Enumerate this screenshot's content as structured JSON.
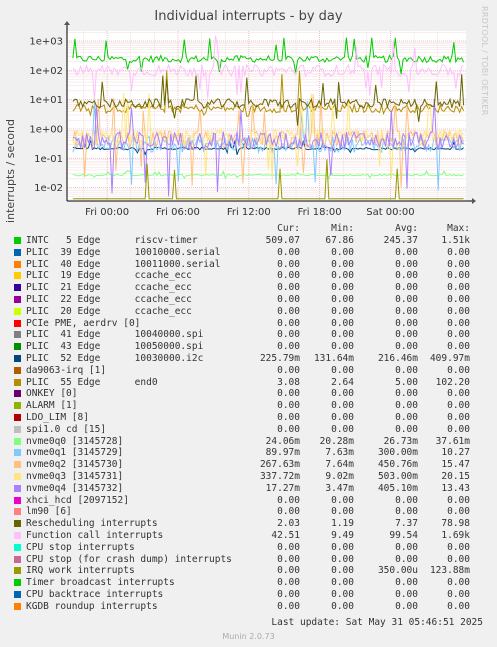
{
  "chart_data": {
    "type": "line",
    "title": "Individual interrupts - by day",
    "ylabel": "interrupts / second",
    "yscale": "log",
    "ylim": [
      0.0035,
      2200
    ],
    "y_ticks": [
      0.01,
      0.1,
      1,
      10,
      100,
      1000
    ],
    "y_tick_labels": [
      "1e-02",
      "1e-01",
      "1e+00",
      "1e+01",
      "1e+02",
      "1e+03"
    ],
    "x_ticks": [
      "Fri 00:00",
      "Fri 06:00",
      "Fri 12:00",
      "Fri 18:00",
      "Sat 00:00"
    ],
    "x_hours": [
      0,
      6,
      12,
      18,
      24
    ],
    "x_range_hours": [
      -3.4,
      30.4
    ],
    "grid": true,
    "legend_columns": [
      "Cur:",
      "Min:",
      "Avg:",
      "Max:"
    ],
    "series": [
      {
        "name": "INTC   5 Edge      riscv-timer",
        "color": "#00cc00",
        "cur": "509.07",
        "min": "67.86",
        "avg": "245.37",
        "max": "1.51k"
      },
      {
        "name": "PLIC  39 Edge      10010000.serial",
        "color": "#0066b3",
        "cur": "0.00",
        "min": "0.00",
        "avg": "0.00",
        "max": "0.00"
      },
      {
        "name": "PLIC  40 Edge      10011000.serial",
        "color": "#ff8000",
        "cur": "0.00",
        "min": "0.00",
        "avg": "0.00",
        "max": "0.00"
      },
      {
        "name": "PLIC  19 Edge      ccache_ecc",
        "color": "#ffcc00",
        "cur": "0.00",
        "min": "0.00",
        "avg": "0.00",
        "max": "0.00"
      },
      {
        "name": "PLIC  21 Edge      ccache_ecc",
        "color": "#330099",
        "cur": "0.00",
        "min": "0.00",
        "avg": "0.00",
        "max": "0.00"
      },
      {
        "name": "PLIC  22 Edge      ccache_ecc",
        "color": "#990099",
        "cur": "0.00",
        "min": "0.00",
        "avg": "0.00",
        "max": "0.00"
      },
      {
        "name": "PLIC  20 Edge      ccache_ecc",
        "color": "#ccff00",
        "cur": "0.00",
        "min": "0.00",
        "avg": "0.00",
        "max": "0.00"
      },
      {
        "name": "PCIe PME, aerdrv [0]",
        "color": "#ff0000",
        "cur": "0.00",
        "min": "0.00",
        "avg": "0.00",
        "max": "0.00"
      },
      {
        "name": "PLIC  41 Edge      10040000.spi",
        "color": "#808080",
        "cur": "0.00",
        "min": "0.00",
        "avg": "0.00",
        "max": "0.00"
      },
      {
        "name": "PLIC  43 Edge      10050000.spi",
        "color": "#008f00",
        "cur": "0.00",
        "min": "0.00",
        "avg": "0.00",
        "max": "0.00"
      },
      {
        "name": "PLIC  52 Edge      10030000.i2c",
        "color": "#00487d",
        "cur": "225.79m",
        "min": "131.64m",
        "avg": "216.46m",
        "max": "409.97m"
      },
      {
        "name": "da9063-irq [1]",
        "color": "#b35a00",
        "cur": "0.00",
        "min": "0.00",
        "avg": "0.00",
        "max": "0.00"
      },
      {
        "name": "PLIC  55 Edge      end0",
        "color": "#b38f00",
        "cur": "3.08",
        "min": "2.64",
        "avg": "5.00",
        "max": "102.20"
      },
      {
        "name": "ONKEY [0]",
        "color": "#6b006b",
        "cur": "0.00",
        "min": "0.00",
        "avg": "0.00",
        "max": "0.00"
      },
      {
        "name": "ALARM [1]",
        "color": "#8fb300",
        "cur": "0.00",
        "min": "0.00",
        "avg": "0.00",
        "max": "0.00"
      },
      {
        "name": "LDO_LIM [8]",
        "color": "#b30000",
        "cur": "0.00",
        "min": "0.00",
        "avg": "0.00",
        "max": "0.00"
      },
      {
        "name": "spi1.0 cd [15]",
        "color": "#bebebe",
        "cur": "0.00",
        "min": "0.00",
        "avg": "0.00",
        "max": "0.00"
      },
      {
        "name": "nvme0q0 [3145728]",
        "color": "#80ff80",
        "cur": "24.06m",
        "min": "20.28m",
        "avg": "26.73m",
        "max": "37.61m"
      },
      {
        "name": "nvme0q1 [3145729]",
        "color": "#80c9ff",
        "cur": "89.97m",
        "min": "7.63m",
        "avg": "300.00m",
        "max": "10.27"
      },
      {
        "name": "nvme0q2 [3145730]",
        "color": "#ffc080",
        "cur": "267.63m",
        "min": "7.64m",
        "avg": "450.76m",
        "max": "15.47"
      },
      {
        "name": "nvme0q3 [3145731]",
        "color": "#ffe680",
        "cur": "337.72m",
        "min": "9.02m",
        "avg": "503.00m",
        "max": "20.15"
      },
      {
        "name": "nvme0q4 [3145732]",
        "color": "#aa80ff",
        "cur": "17.27m",
        "min": "3.47m",
        "avg": "405.10m",
        "max": "13.43"
      },
      {
        "name": "xhci_hcd [2097152]",
        "color": "#ee00cc",
        "cur": "0.00",
        "min": "0.00",
        "avg": "0.00",
        "max": "0.00"
      },
      {
        "name": "lm90 [6]",
        "color": "#ff8080",
        "cur": "0.00",
        "min": "0.00",
        "avg": "0.00",
        "max": "0.00"
      },
      {
        "name": "Rescheduling interrupts",
        "color": "#666600",
        "cur": "2.03",
        "min": "1.19",
        "avg": "7.37",
        "max": "78.98"
      },
      {
        "name": "Function call interrupts",
        "color": "#ffbfff",
        "cur": "42.51",
        "min": "9.49",
        "avg": "99.54",
        "max": "1.69k"
      },
      {
        "name": "CPU stop interrupts",
        "color": "#00ffcc",
        "cur": "0.00",
        "min": "0.00",
        "avg": "0.00",
        "max": "0.00"
      },
      {
        "name": "CPU stop (for crash dump) interrupts",
        "color": "#cc6699",
        "cur": "0.00",
        "min": "0.00",
        "avg": "0.00",
        "max": "0.00"
      },
      {
        "name": "IRQ work interrupts",
        "color": "#999900",
        "cur": "0.00",
        "min": "0.00",
        "avg": "350.00u",
        "max": "123.88m"
      },
      {
        "name": "Timer broadcast interrupts",
        "color": "#00cc00",
        "cur": "0.00",
        "min": "0.00",
        "avg": "0.00",
        "max": "0.00"
      },
      {
        "name": "CPU backtrace interrupts",
        "color": "#0066b3",
        "cur": "0.00",
        "min": "0.00",
        "avg": "0.00",
        "max": "0.00"
      },
      {
        "name": "KGDB roundup interrupts",
        "color": "#ff8000",
        "cur": "0.00",
        "min": "0.00",
        "avg": "0.00",
        "max": "0.00"
      }
    ]
  },
  "side_label": "RRDTOOL / TOBI OETIKER",
  "last_update": "Last update: Sat May 31 05:46:51 2025",
  "footer": "Munin 2.0.73"
}
